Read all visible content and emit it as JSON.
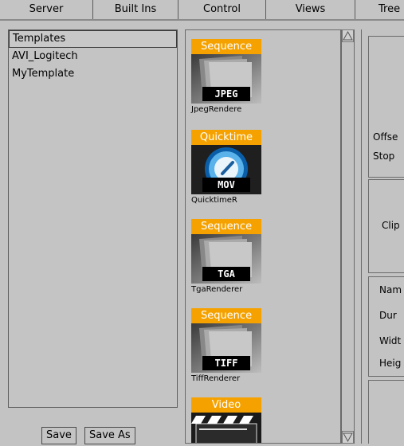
{
  "tabs": [
    "Server",
    "Built Ins",
    "Control",
    "Views",
    "Tree"
  ],
  "templates": [
    "Templates",
    "AVI_Logitech",
    "MyTemplate"
  ],
  "buttons": {
    "save": "Save",
    "save_as": "Save As"
  },
  "renderers": [
    {
      "header": "Sequence",
      "format": "JPEG",
      "caption": "JpegRendere",
      "icon": "sequence-icon"
    },
    {
      "header": "Quicktime",
      "format": "MOV",
      "caption": "QuicktimeR",
      "icon": "quicktime-icon"
    },
    {
      "header": "Sequence",
      "format": "TGA",
      "caption": "TgaRenderer",
      "icon": "sequence-icon"
    },
    {
      "header": "Sequence",
      "format": "TIFF",
      "caption": "TiffRenderer",
      "icon": "sequence-icon"
    },
    {
      "header": "Video",
      "format": "",
      "caption": "",
      "icon": "clapperboard-icon"
    }
  ],
  "right_panel": {
    "offset": "Offse",
    "stop": "Stop",
    "clip": "Clip",
    "name": "Nam",
    "duration": "Dur",
    "width": "Widt",
    "height": "Heig"
  },
  "colors": {
    "header": "#f5a200",
    "panel": "#c3c3c3"
  }
}
